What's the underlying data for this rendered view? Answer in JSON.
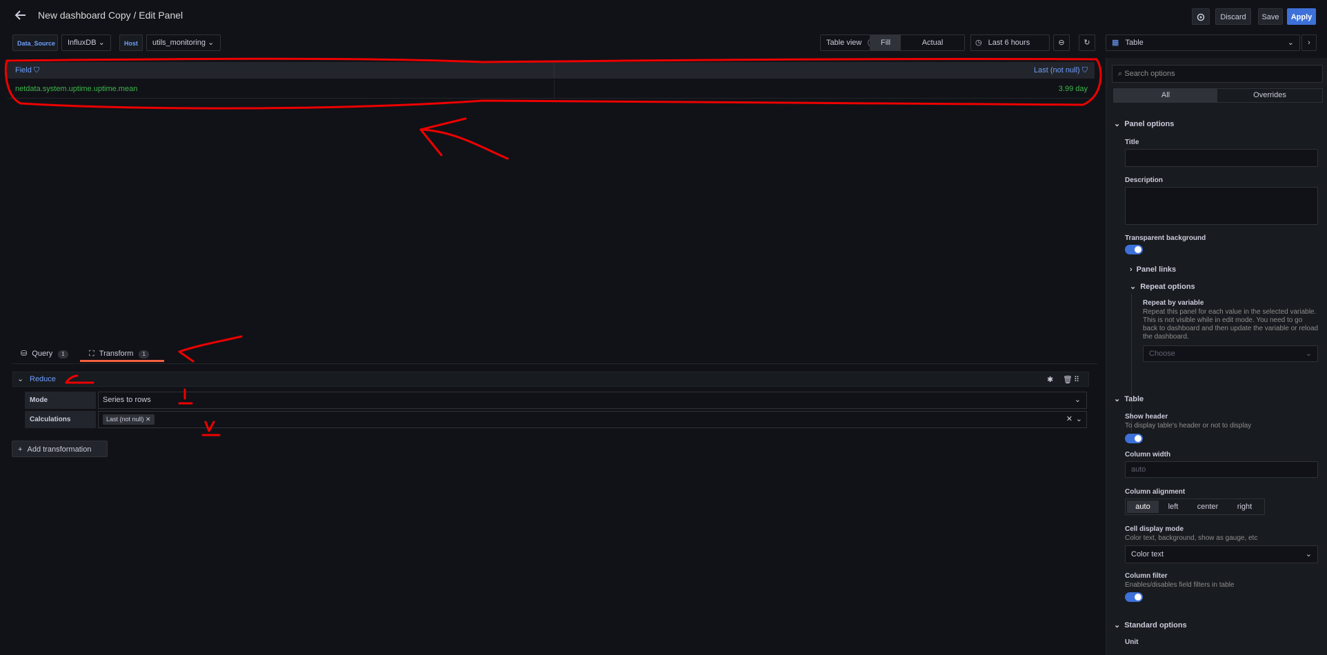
{
  "header": {
    "title": "New dashboard Copy / Edit Panel",
    "discard": "Discard",
    "save": "Save",
    "apply": "Apply"
  },
  "variables": {
    "ds_label": "Data_Source",
    "ds_value": "InfluxDB",
    "host_label": "Host",
    "host_value": "utils_monitoring"
  },
  "toolbar": {
    "table_view": "Table view",
    "fill": "Fill",
    "actual": "Actual",
    "time_range": "Last 6 hours",
    "viz": "Table"
  },
  "table": {
    "col1": "Field",
    "col2": "Last (not null)",
    "rows": [
      {
        "field": "netdata.system.uptime.uptime.mean",
        "value": "3.99 day"
      }
    ]
  },
  "tabs": {
    "query": "Query",
    "query_count": "1",
    "transform": "Transform",
    "transform_count": "1"
  },
  "transform": {
    "name": "Reduce",
    "mode_label": "Mode",
    "mode_value": "Series to rows",
    "calc_label": "Calculations",
    "calc_value": "Last (not null)",
    "add": "Add transformation"
  },
  "options": {
    "search_placeholder": "Search options",
    "all": "All",
    "overrides": "Overrides",
    "panel_options": "Panel options",
    "title": "Title",
    "description": "Description",
    "transparent": "Transparent background",
    "panel_links": "Panel links",
    "repeat_options": "Repeat options",
    "repeat_by": "Repeat by variable",
    "repeat_desc": "Repeat this panel for each value in the selected variable. This is not visible while in edit mode. You need to go back to dashboard and then update the variable or reload the dashboard.",
    "choose": "Choose",
    "table_section": "Table",
    "show_header": "Show header",
    "show_header_desc": "To display table's header or not to display",
    "column_width": "Column width",
    "column_width_ph": "auto",
    "column_alignment": "Column alignment",
    "align": [
      "auto",
      "left",
      "center",
      "right"
    ],
    "cell_display": "Cell display mode",
    "cell_display_desc": "Color text, background, show as gauge, etc",
    "cell_display_value": "Color text",
    "column_filter": "Column filter",
    "column_filter_desc": "Enables/disables field filters in table",
    "standard_options": "Standard options",
    "unit": "Unit"
  }
}
